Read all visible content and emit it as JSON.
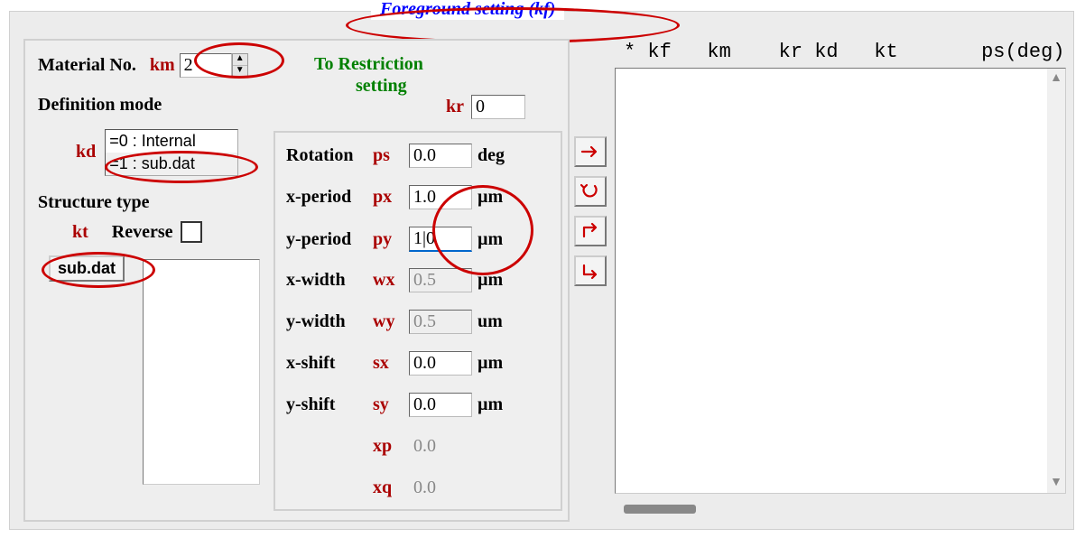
{
  "frame_title": "Foreground setting (kf)",
  "material": {
    "label": "Material No.",
    "var": "km",
    "value": "2"
  },
  "to_restriction": {
    "line1": "To Restriction",
    "line2": "setting",
    "var": "kr",
    "value": "0"
  },
  "definition_mode": {
    "label": "Definition mode",
    "var": "kd",
    "options": [
      "=0 : Internal",
      "=1 : sub.dat"
    ],
    "selected_index": 1
  },
  "structure_type": {
    "label": "Structure type",
    "var": "kt",
    "reverse_label": "Reverse",
    "reverse_checked": false,
    "subdat_label": "sub.dat"
  },
  "params": {
    "rotation": {
      "label": "Rotation",
      "var": "ps",
      "value": "0.0",
      "unit": "deg",
      "disabled": false
    },
    "xperiod": {
      "label": "x-period",
      "var": "px",
      "value": "1.0",
      "unit": "µm",
      "disabled": false
    },
    "yperiod": {
      "label": "y-period",
      "var": "py",
      "value": "1|0",
      "unit": "µm",
      "disabled": false
    },
    "xwidth": {
      "label": "x-width",
      "var": "wx",
      "value": "0.5",
      "unit": "µm",
      "disabled": true
    },
    "ywidth": {
      "label": "y-width",
      "var": "wy",
      "value": "0.5",
      "unit": "um",
      "disabled": true
    },
    "xshift": {
      "label": "x-shift",
      "var": "sx",
      "value": "0.0",
      "unit": "µm",
      "disabled": false
    },
    "yshift": {
      "label": "y-shift",
      "var": "sy",
      "value": "0.0",
      "unit": "µm",
      "disabled": false
    },
    "xp": {
      "label": "",
      "var": "xp",
      "value": "0.0",
      "unit": "",
      "disabled": true
    },
    "xq": {
      "label": "",
      "var": "xq",
      "value": "0.0",
      "unit": "",
      "disabled": true
    }
  },
  "arrows": {
    "right": "→",
    "replace": "↻",
    "insert": "↱",
    "append": "↳"
  },
  "columns": "* kf   km    kr kd   kt       ps(deg)"
}
